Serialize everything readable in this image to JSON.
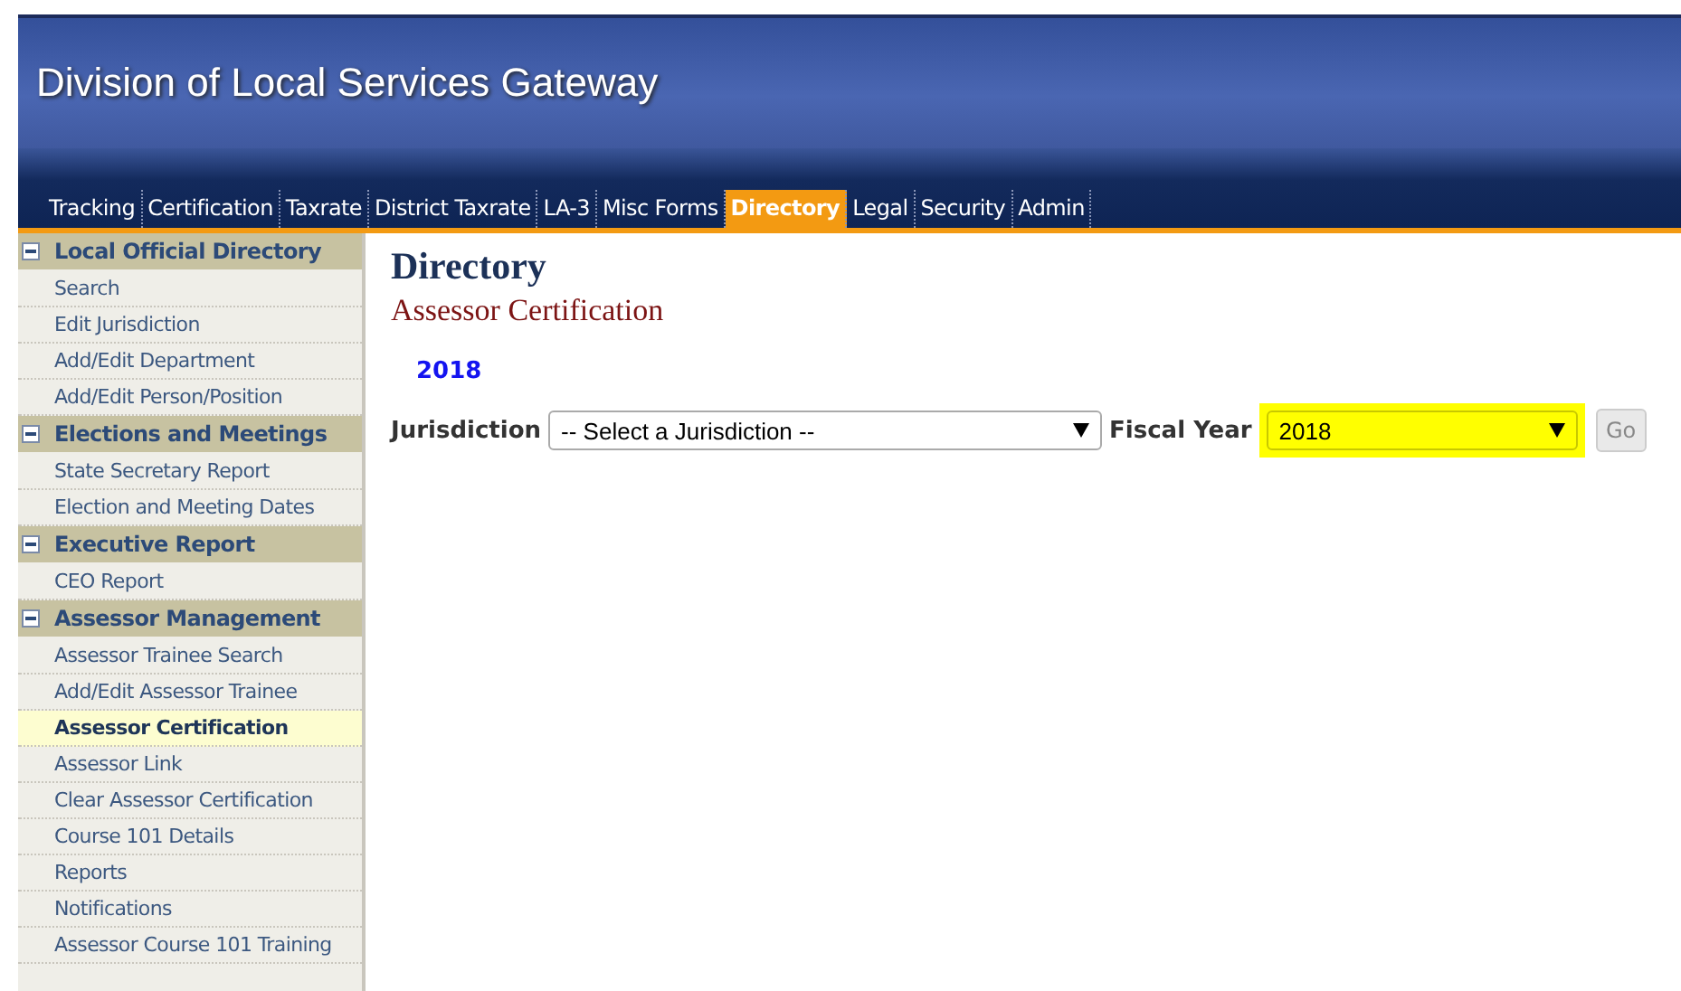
{
  "header": {
    "title": "Division of Local Services Gateway"
  },
  "nav": [
    {
      "label": "Tracking",
      "selected": false
    },
    {
      "label": "Certification",
      "selected": false
    },
    {
      "label": "Taxrate",
      "selected": false
    },
    {
      "label": "District Taxrate",
      "selected": false
    },
    {
      "label": "LA-3",
      "selected": false
    },
    {
      "label": "Misc Forms",
      "selected": false
    },
    {
      "label": "Directory",
      "selected": true
    },
    {
      "label": "Legal",
      "selected": false
    },
    {
      "label": "Security",
      "selected": false
    },
    {
      "label": "Admin",
      "selected": false
    }
  ],
  "sidebar": [
    {
      "title": "Local Official Directory",
      "expanded": true,
      "items": [
        {
          "label": "Search",
          "selected": false
        },
        {
          "label": "Edit Jurisdiction",
          "selected": false
        },
        {
          "label": "Add/Edit Department",
          "selected": false
        },
        {
          "label": "Add/Edit Person/Position",
          "selected": false
        }
      ]
    },
    {
      "title": "Elections and Meetings",
      "expanded": true,
      "items": [
        {
          "label": "State Secretary Report",
          "selected": false
        },
        {
          "label": "Election and Meeting Dates",
          "selected": false
        }
      ]
    },
    {
      "title": "Executive Report",
      "expanded": true,
      "items": [
        {
          "label": "CEO Report",
          "selected": false
        }
      ]
    },
    {
      "title": "Assessor Management",
      "expanded": true,
      "items": [
        {
          "label": "Assessor Trainee Search",
          "selected": false
        },
        {
          "label": "Add/Edit Assessor Trainee",
          "selected": false
        },
        {
          "label": "Assessor Certification",
          "selected": true
        },
        {
          "label": "Assessor Link",
          "selected": false
        },
        {
          "label": "Clear Assessor Certification",
          "selected": false
        },
        {
          "label": "Course 101 Details",
          "selected": false
        },
        {
          "label": "Reports",
          "selected": false
        },
        {
          "label": "Notifications",
          "selected": false
        },
        {
          "label": "Assessor Course 101 Training",
          "selected": false
        }
      ]
    }
  ],
  "main": {
    "heading": "Directory",
    "subheading": "Assessor Certification",
    "year_link": "2018",
    "form": {
      "jurisdiction_label": "Jurisdiction",
      "jurisdiction_value": "-- Select a Jurisdiction --",
      "fiscal_year_label": "Fiscal Year",
      "fiscal_year_value": "2018",
      "fiscal_year_highlighted": true,
      "go_button": "Go",
      "go_disabled": true
    }
  }
}
